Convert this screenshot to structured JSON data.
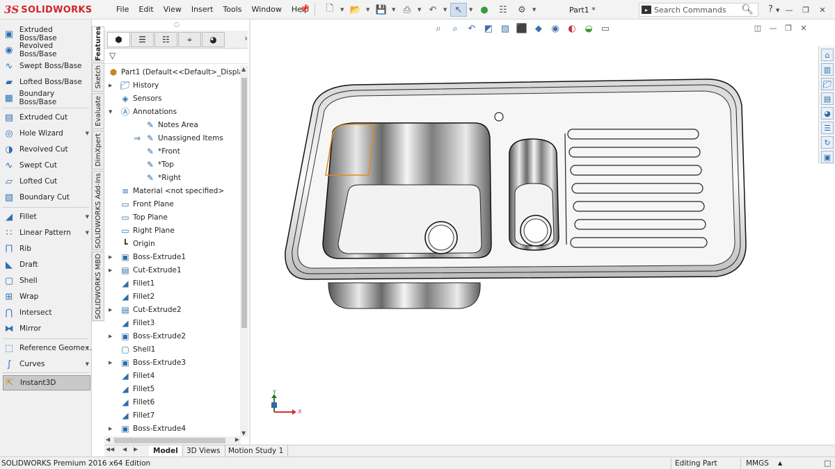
{
  "app": {
    "brand_prefix": "3S",
    "brand": "SOLIDWORKS",
    "document": "Part1 *"
  },
  "menu": [
    "File",
    "Edit",
    "View",
    "Insert",
    "Tools",
    "Window",
    "Help"
  ],
  "search": {
    "placeholder": "Search Commands"
  },
  "help_label": "?",
  "command_manager": {
    "features": [
      {
        "label": "Extruded Boss/Base",
        "icon": "extruded-boss-icon"
      },
      {
        "label": "Revolved Boss/Base",
        "icon": "revolved-boss-icon"
      },
      {
        "label": "Swept Boss/Base",
        "icon": "swept-boss-icon"
      },
      {
        "label": "Lofted Boss/Base",
        "icon": "lofted-boss-icon"
      },
      {
        "label": "Boundary Boss/Base",
        "icon": "boundary-boss-icon"
      },
      {
        "label": "Extruded Cut",
        "icon": "extruded-cut-icon"
      },
      {
        "label": "Hole Wizard",
        "icon": "hole-wizard-icon"
      },
      {
        "label": "Revolved Cut",
        "icon": "revolved-cut-icon"
      },
      {
        "label": "Swept Cut",
        "icon": "swept-cut-icon"
      },
      {
        "label": "Lofted Cut",
        "icon": "lofted-cut-icon"
      },
      {
        "label": "Boundary Cut",
        "icon": "boundary-cut-icon"
      },
      {
        "label": "Fillet",
        "icon": "fillet-icon"
      },
      {
        "label": "Linear Pattern",
        "icon": "linear-pattern-icon"
      },
      {
        "label": "Rib",
        "icon": "rib-icon"
      },
      {
        "label": "Draft",
        "icon": "draft-icon"
      },
      {
        "label": "Shell",
        "icon": "shell-icon"
      },
      {
        "label": "Wrap",
        "icon": "wrap-icon"
      },
      {
        "label": "Intersect",
        "icon": "intersect-icon"
      },
      {
        "label": "Mirror",
        "icon": "mirror-icon"
      },
      {
        "label": "Reference Geome...",
        "icon": "reference-geometry-icon"
      },
      {
        "label": "Curves",
        "icon": "curves-icon"
      },
      {
        "label": "Instant3D",
        "icon": "instant3d-icon"
      }
    ]
  },
  "vertical_tabs": [
    "Features",
    "Sketch",
    "Evaluate",
    "DimXpert",
    "SOLIDWORKS Add-Ins",
    "SOLIDWORKS MBD"
  ],
  "tree": {
    "root": "Part1  (Default<<Default>_Display Sta",
    "items": [
      {
        "label": "History",
        "icon": "history-folder-icon"
      },
      {
        "label": "Sensors",
        "icon": "sensors-icon"
      },
      {
        "label": "Annotations",
        "icon": "annotations-icon"
      },
      {
        "label": "Notes Area",
        "icon": "notes-area-icon"
      },
      {
        "label": "Unassigned Items",
        "icon": "unassigned-items-icon"
      },
      {
        "label": "*Front",
        "icon": "annotation-view-icon"
      },
      {
        "label": "*Top",
        "icon": "annotation-view-icon"
      },
      {
        "label": "*Right",
        "icon": "annotation-view-icon"
      },
      {
        "label": "Material <not specified>",
        "icon": "material-icon"
      },
      {
        "label": "Front Plane",
        "icon": "plane-icon"
      },
      {
        "label": "Top Plane",
        "icon": "plane-icon"
      },
      {
        "label": "Right Plane",
        "icon": "plane-icon"
      },
      {
        "label": "Origin",
        "icon": "origin-icon"
      },
      {
        "label": "Boss-Extrude1",
        "icon": "boss-extrude-icon"
      },
      {
        "label": "Cut-Extrude1",
        "icon": "cut-extrude-icon"
      },
      {
        "label": "Fillet1",
        "icon": "fillet-feature-icon"
      },
      {
        "label": "Fillet2",
        "icon": "fillet-feature-icon"
      },
      {
        "label": "Cut-Extrude2",
        "icon": "cut-extrude-icon"
      },
      {
        "label": "Fillet3",
        "icon": "fillet-feature-icon"
      },
      {
        "label": "Boss-Extrude2",
        "icon": "boss-extrude-icon"
      },
      {
        "label": "Shell1",
        "icon": "shell-feature-icon"
      },
      {
        "label": "Boss-Extrude3",
        "icon": "boss-extrude-icon"
      },
      {
        "label": "Fillet4",
        "icon": "fillet-feature-icon"
      },
      {
        "label": "Fillet5",
        "icon": "fillet-feature-icon"
      },
      {
        "label": "Fillet6",
        "icon": "fillet-feature-icon"
      },
      {
        "label": "Fillet7",
        "icon": "fillet-feature-icon"
      },
      {
        "label": "Boss-Extrude4",
        "icon": "boss-extrude-icon"
      }
    ]
  },
  "bottom_tabs": [
    "Model",
    "3D Views",
    "Motion Study 1"
  ],
  "triad": {
    "x": "X",
    "y": "Y"
  },
  "status": {
    "edition": "SOLIDWORKS Premium 2016 x64 Edition",
    "mode": "Editing Part",
    "units": "MMGS"
  },
  "colors": {
    "brand": "#d2232a",
    "selection": "#e08a1e",
    "icon_blue": "#2d6da8"
  }
}
